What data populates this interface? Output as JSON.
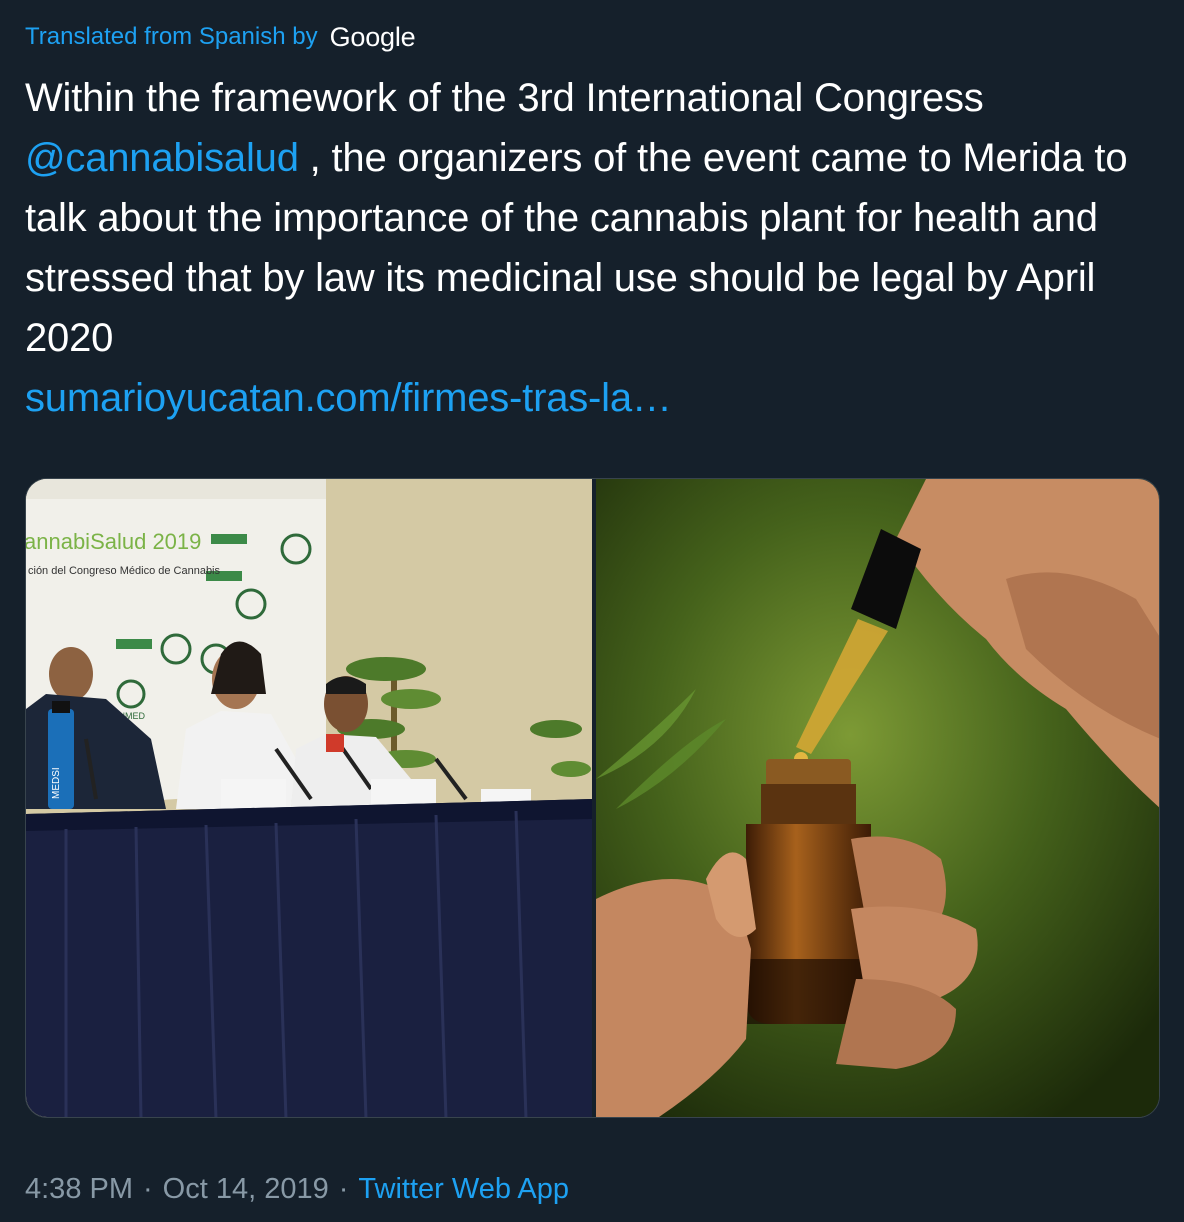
{
  "translation": {
    "label": "Translated from Spanish by",
    "provider": "Google"
  },
  "tweet": {
    "text_line1": "Within the framework of the 3rd International Congress",
    "mention": "@cannabisalud",
    "text_after_mention": " , the organizers of the event came to Merida to talk about the importance of the cannabis plant for health and stressed that by law its medicinal use should be legal by April 2020",
    "link": "sumarioyucatan.com/firmes-tras-la…"
  },
  "media": {
    "photo_left_banner_title": "annabiSalud 2019",
    "photo_left_banner_subtitle": "ción del Congreso Médico de Cannabis",
    "photo_left_logo_text": "SUNMED",
    "photo_left_bottle_text": "MEDSI"
  },
  "footer": {
    "time": "4:38 PM",
    "separator": "·",
    "date": "Oct 14, 2019",
    "source": "Twitter Web App"
  },
  "colors": {
    "background": "#15202b",
    "accent": "#1da1f2",
    "muted": "#8899a6"
  }
}
